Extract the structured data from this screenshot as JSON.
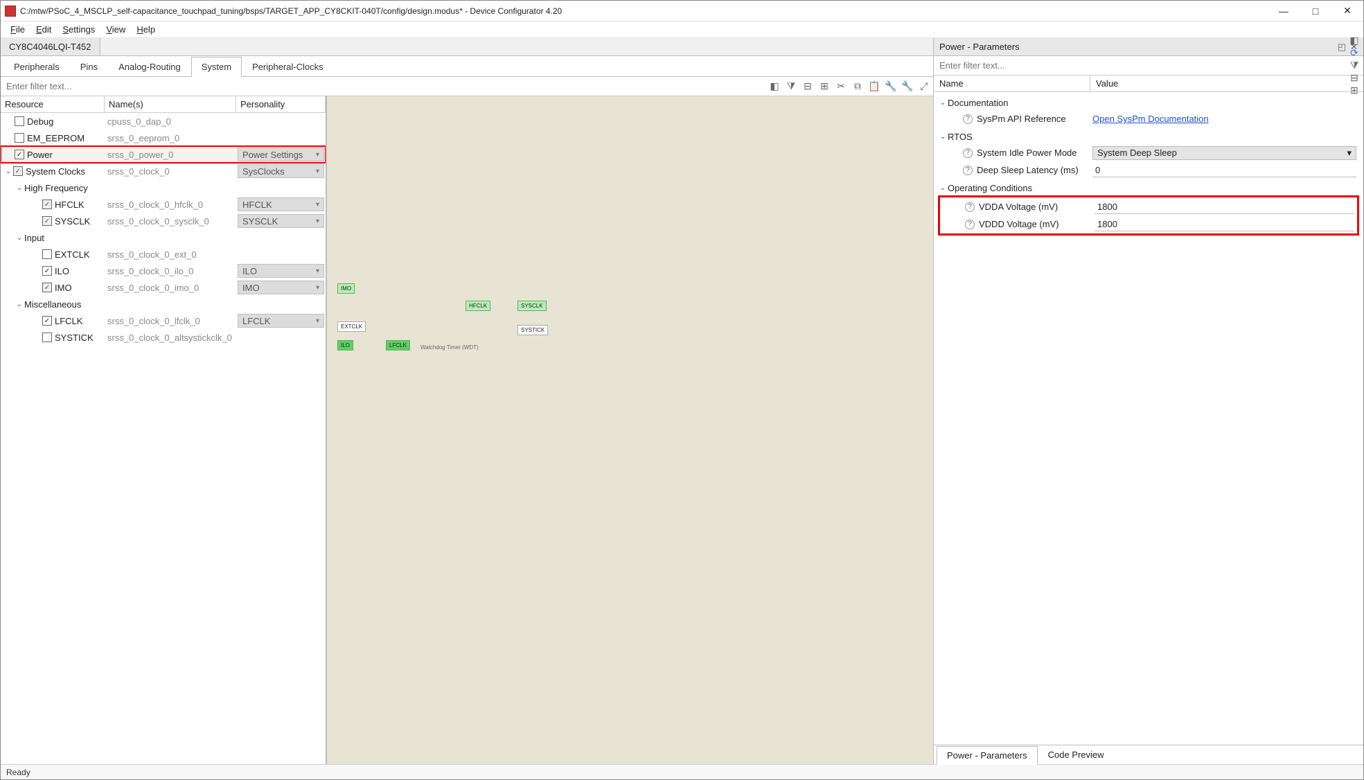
{
  "window": {
    "title": "C:/mtw/PSoC_4_MSCLP_self-capacitance_touchpad_tuning/bsps/TARGET_APP_CY8CKIT-040T/config/design.modus* - Device Configurator 4.20"
  },
  "menu": {
    "file": "File",
    "edit": "Edit",
    "settings": "Settings",
    "view": "View",
    "help": "Help"
  },
  "device_tab": "CY8C4046LQI-T452",
  "category_tabs": {
    "peripherals": "Peripherals",
    "pins": "Pins",
    "analog": "Analog-Routing",
    "system": "System",
    "pclocks": "Peripheral-Clocks"
  },
  "left_filter_placeholder": "Enter filter text...",
  "columns": {
    "resource": "Resource",
    "names": "Name(s)",
    "personality": "Personality"
  },
  "tree": {
    "debug": {
      "label": "Debug",
      "name": "cpuss_0_dap_0"
    },
    "eeprom": {
      "label": "EM_EEPROM",
      "name": "srss_0_eeprom_0"
    },
    "power": {
      "label": "Power",
      "name": "srss_0_power_0",
      "pers": "Power Settings"
    },
    "sysclocks": {
      "label": "System Clocks",
      "name": "srss_0_clock_0",
      "pers": "SysClocks"
    },
    "highfreq": {
      "label": "High Frequency"
    },
    "hfclk": {
      "label": "HFCLK",
      "name": "srss_0_clock_0_hfclk_0",
      "pers": "HFCLK"
    },
    "sysclk": {
      "label": "SYSCLK",
      "name": "srss_0_clock_0_sysclk_0",
      "pers": "SYSCLK"
    },
    "input": {
      "label": "Input"
    },
    "extclk": {
      "label": "EXTCLK",
      "name": "srss_0_clock_0_ext_0"
    },
    "ilo": {
      "label": "ILO",
      "name": "srss_0_clock_0_ilo_0",
      "pers": "ILO"
    },
    "imo": {
      "label": "IMO",
      "name": "srss_0_clock_0_imo_0",
      "pers": "IMO"
    },
    "misc": {
      "label": "Miscellaneous"
    },
    "lfclk": {
      "label": "LFCLK",
      "name": "srss_0_clock_0_lfclk_0",
      "pers": "LFCLK"
    },
    "systick": {
      "label": "SYSTICK",
      "name": "srss_0_clock_0_altsystickclk_0"
    }
  },
  "canvas": {
    "imo": "IMO",
    "extclk": "EXTCLK",
    "ilo": "ILO",
    "lfclk": "LFCLK",
    "hfclk": "HFCLK",
    "sysclk": "SYSCLK",
    "systick": "SYSTICK",
    "wdt": "Watchdog Timer (WDT)"
  },
  "right": {
    "panel_title": "Power - Parameters",
    "filter_placeholder": "Enter filter text...",
    "col_name": "Name",
    "col_value": "Value",
    "groups": {
      "doc": {
        "label": "Documentation",
        "syspm_label": "SysPm API Reference",
        "syspm_link": "Open SysPm Documentation"
      },
      "rtos": {
        "label": "RTOS",
        "idle_label": "System Idle Power Mode",
        "idle_value": "System Deep Sleep",
        "lat_label": "Deep Sleep Latency (ms)",
        "lat_value": "0"
      },
      "op": {
        "label": "Operating Conditions",
        "vdda_label": "VDDA Voltage (mV)",
        "vdda_value": "1800",
        "vddd_label": "VDDD Voltage (mV)",
        "vddd_value": "1800"
      }
    },
    "bottom_tabs": {
      "params": "Power - Parameters",
      "code": "Code Preview"
    }
  },
  "status": "Ready"
}
